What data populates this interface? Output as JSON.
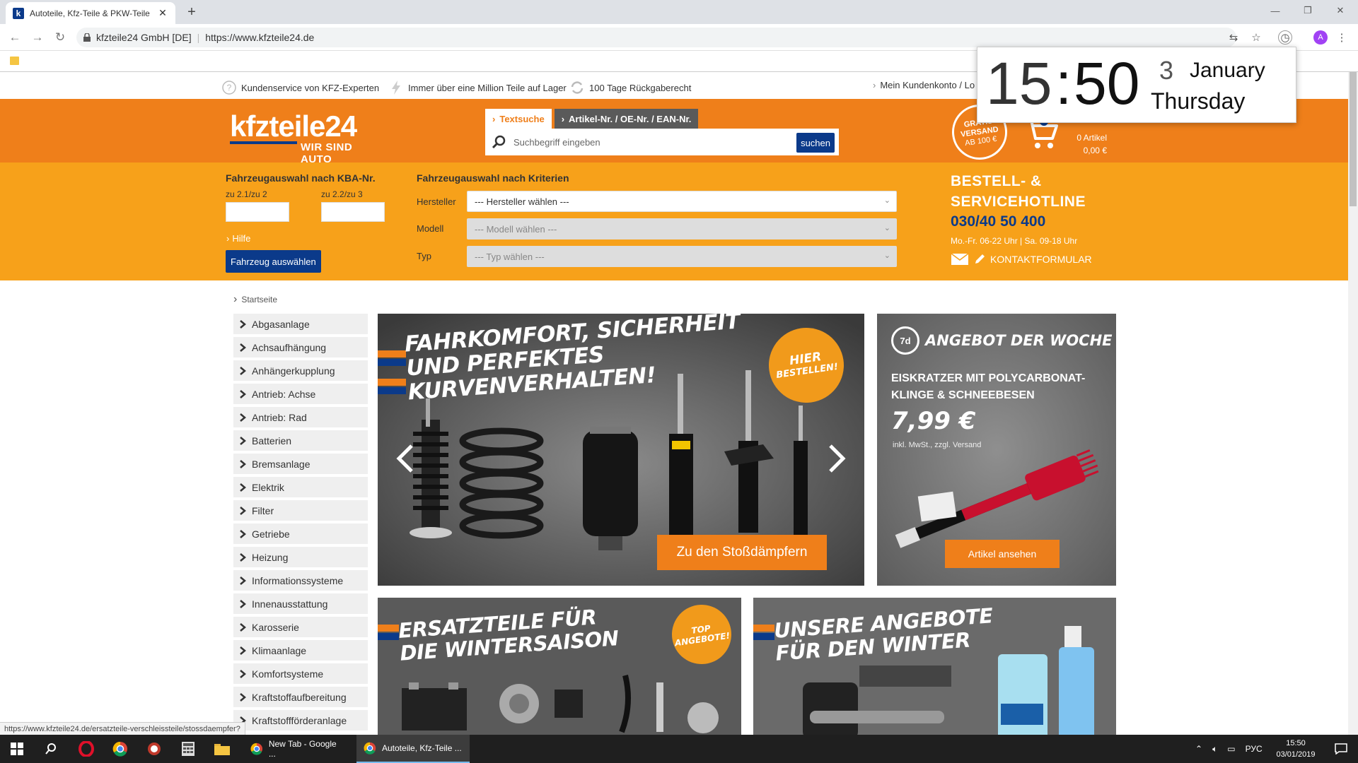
{
  "browser": {
    "tab_title": "Autoteile, Kfz-Teile & PKW-Teile",
    "tab_favicon_letter": "k",
    "site_name": "kfzteile24 GmbH [DE]",
    "url": "https://www.kfzteile24.de",
    "avatar_letter": "A"
  },
  "infobar": {
    "items": [
      {
        "label": "Kundenservice von KFZ-Experten",
        "icon": "question-icon"
      },
      {
        "label": "Immer über eine Million Teile auf Lager",
        "icon": "lightning-icon"
      },
      {
        "label": "100 Tage Rückgaberecht",
        "icon": "return-arrows-icon"
      }
    ],
    "account_label": "Mein Kundenkonto / Lo"
  },
  "header": {
    "logo_text": "kfzteile24",
    "logo_slogan": "WIR SIND AUTO",
    "search_tabs": [
      "Textsuche",
      "Artikel-Nr. / OE-Nr. / EAN-Nr."
    ],
    "search_placeholder": "Suchbegriff eingeben",
    "search_button": "suchen",
    "shipping_badge": [
      "GRATIS",
      "VERSAND",
      "AB 100 €"
    ],
    "cart_items": "0 Artikel",
    "cart_total": "0,00 €"
  },
  "vehicle": {
    "kba_title": "Fahrzeugauswahl nach KBA-Nr.",
    "kba_label_1": "zu 2.1/zu 2",
    "kba_label_2": "zu 2.2/zu 3",
    "help_link": "Hilfe",
    "select_button": "Fahrzeug auswählen",
    "criteria_title": "Fahrzeugauswahl nach Kriterien",
    "fields": [
      {
        "label": "Hersteller",
        "value": "--- Hersteller wählen ---"
      },
      {
        "label": "Modell",
        "value": "--- Modell wählen ---"
      },
      {
        "label": "Typ",
        "value": "--- Typ wählen ---"
      }
    ],
    "hotline_title_1": "BESTELL- &",
    "hotline_title_2": "SERVICEHOTLINE",
    "hotline_number": "030/40 50 400",
    "hotline_hours": "Mo.-Fr. 06-22 Uhr | Sa. 09-18 Uhr",
    "contact_link": "KONTAKTFORMULAR"
  },
  "breadcrumb": "Startseite",
  "sidebar": {
    "items": [
      "Abgasanlage",
      "Achsaufhängung",
      "Anhängerkupplung",
      "Antrieb: Achse",
      "Antrieb: Rad",
      "Batterien",
      "Bremsanlage",
      "Elektrik",
      "Filter",
      "Getriebe",
      "Heizung",
      "Informationssysteme",
      "Innenausstattung",
      "Karosserie",
      "Klimaanlage",
      "Komfortsysteme",
      "Kraftstoffaufbereitung",
      "Kraftstoffförderanlage"
    ]
  },
  "hero": {
    "line1": "FAHRKOMFORT, SICHERHEIT",
    "line2": "UND PERFEKTES",
    "line3": "KURVENVERHALTEN!",
    "badge_1": "HIER",
    "badge_2": "BESTELLEN!",
    "button": "Zu den Stoßdämpfern"
  },
  "offer": {
    "badge": "7d",
    "heading": "ANGEBOT DER WOCHE",
    "title_1": "EISKRATZER MIT POLYCARBONAT-",
    "title_2": "KLINGE & SCHNEEBESEN",
    "price": "7,99 €",
    "note": "inkl. MwSt., zzgl. Versand",
    "button": "Artikel ansehen"
  },
  "promo1": {
    "line1": "ERSATZTEILE FÜR",
    "line2": "DIE WINTERSAISON",
    "badge_1": "TOP",
    "badge_2": "ANGEBOTE!"
  },
  "promo2": {
    "line1": "UNSERE ANGEBOTE",
    "line2": "FÜR DEN WINTER"
  },
  "clock_widget": {
    "hours": "15",
    "minutes": "50",
    "day": "3",
    "month": "January",
    "weekday": "Thursday"
  },
  "status_url": "https://www.kfzteile24.de/ersatzteile-verschleissteile/stossdaempfer?",
  "taskbar": {
    "apps": [
      {
        "label": "New Tab - Google ...",
        "active": false
      },
      {
        "label": "Autoteile, Kfz-Teile ...",
        "active": true
      }
    ],
    "lang": "РУС",
    "time": "15:50",
    "date": "03/01/2019"
  },
  "colors": {
    "brand_orange": "#ef7f1a",
    "light_orange": "#f7a11a",
    "brand_blue": "#0b3a8a"
  }
}
